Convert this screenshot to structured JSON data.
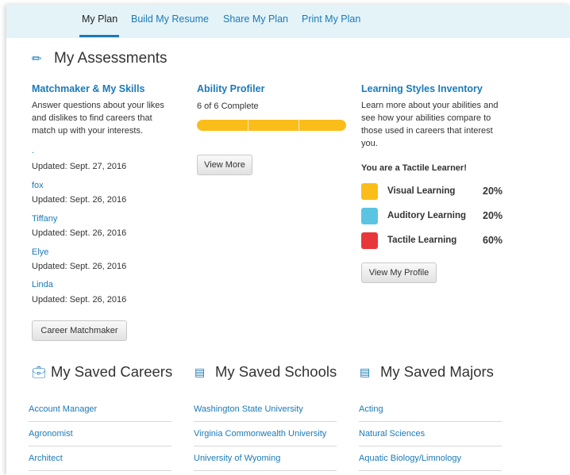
{
  "tabs": [
    {
      "label": "My Plan",
      "active": true
    },
    {
      "label": "Build My Resume",
      "active": false
    },
    {
      "label": "Share My Plan",
      "active": false
    },
    {
      "label": "Print My Plan",
      "active": false
    }
  ],
  "assessments": {
    "title": "My Assessments",
    "icon": "pencil-icon",
    "matchmaker": {
      "title": "Matchmaker & My Skills",
      "description": "Answer questions about your likes and dislikes to find careers that match up with your interests.",
      "entries": [
        {
          "name": ".",
          "updated": "Updated: Sept. 27, 2016"
        },
        {
          "name": "fox",
          "updated": "Updated: Sept. 26, 2016"
        },
        {
          "name": "Tiffany",
          "updated": "Updated: Sept. 26, 2016"
        },
        {
          "name": "Elye",
          "updated": "Updated: Sept. 26, 2016"
        },
        {
          "name": "Linda",
          "updated": "Updated: Sept. 26, 2016"
        }
      ],
      "button": "Career Matchmaker"
    },
    "ability": {
      "title": "Ability Profiler",
      "status": "6 of 6 Complete",
      "progress": 1.0,
      "progress_color": "#fbbd1a",
      "button": "View More"
    },
    "learning": {
      "title": "Learning Styles Inventory",
      "description": "Learn more about your abilities and see how your abilities compare to those used in careers that interest you.",
      "result": "You are a Tactile Learner!",
      "styles": [
        {
          "label": "Visual Learning",
          "percent": "20%",
          "color": "#fbbd1a"
        },
        {
          "label": "Auditory Learning",
          "percent": "20%",
          "color": "#5bc4e3"
        },
        {
          "label": "Tactile Learning",
          "percent": "60%",
          "color": "#e8373b"
        }
      ],
      "button": "View My Profile"
    }
  },
  "saved": {
    "careers": {
      "title": "My Saved Careers",
      "icon": "briefcase-icon",
      "items": [
        "Account Manager",
        "Agronomist",
        "Architect"
      ]
    },
    "schools": {
      "title": "My Saved Schools",
      "icon": "school-icon",
      "items": [
        "Washington State University",
        "Virginia Commonwealth University",
        "University of Wyoming"
      ]
    },
    "majors": {
      "title": "My Saved Majors",
      "icon": "book-icon",
      "items": [
        "Acting",
        "Natural Sciences",
        "Aquatic Biology/Limnology"
      ]
    }
  },
  "accent_color": "#1a7ab8"
}
